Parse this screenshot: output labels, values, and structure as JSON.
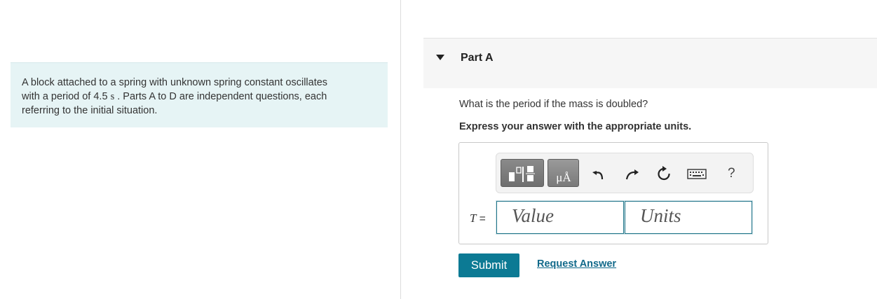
{
  "problem": {
    "line1": "A block attached to a spring with unknown spring constant oscillates",
    "line2_a": "with a period of 4.5 ",
    "line2_unit": "s",
    "line2_b": " . Parts A to D are independent questions, each",
    "line3": "referring to the initial situation."
  },
  "part": {
    "title": "Part A",
    "question": "What is the period if the mass is doubled?",
    "instruction": "Express your answer with the appropriate units."
  },
  "toolbar": {
    "icons": [
      "templates-icon",
      "units-symbol-icon",
      "undo-icon",
      "redo-icon",
      "reset-icon",
      "keyboard-icon",
      "help-icon"
    ],
    "units_symbol": "μÅ",
    "help": "?"
  },
  "answer": {
    "variable": "T",
    "equals": " =",
    "value_placeholder": "Value",
    "units_placeholder": "Units"
  },
  "actions": {
    "submit": "Submit",
    "request": "Request Answer"
  }
}
